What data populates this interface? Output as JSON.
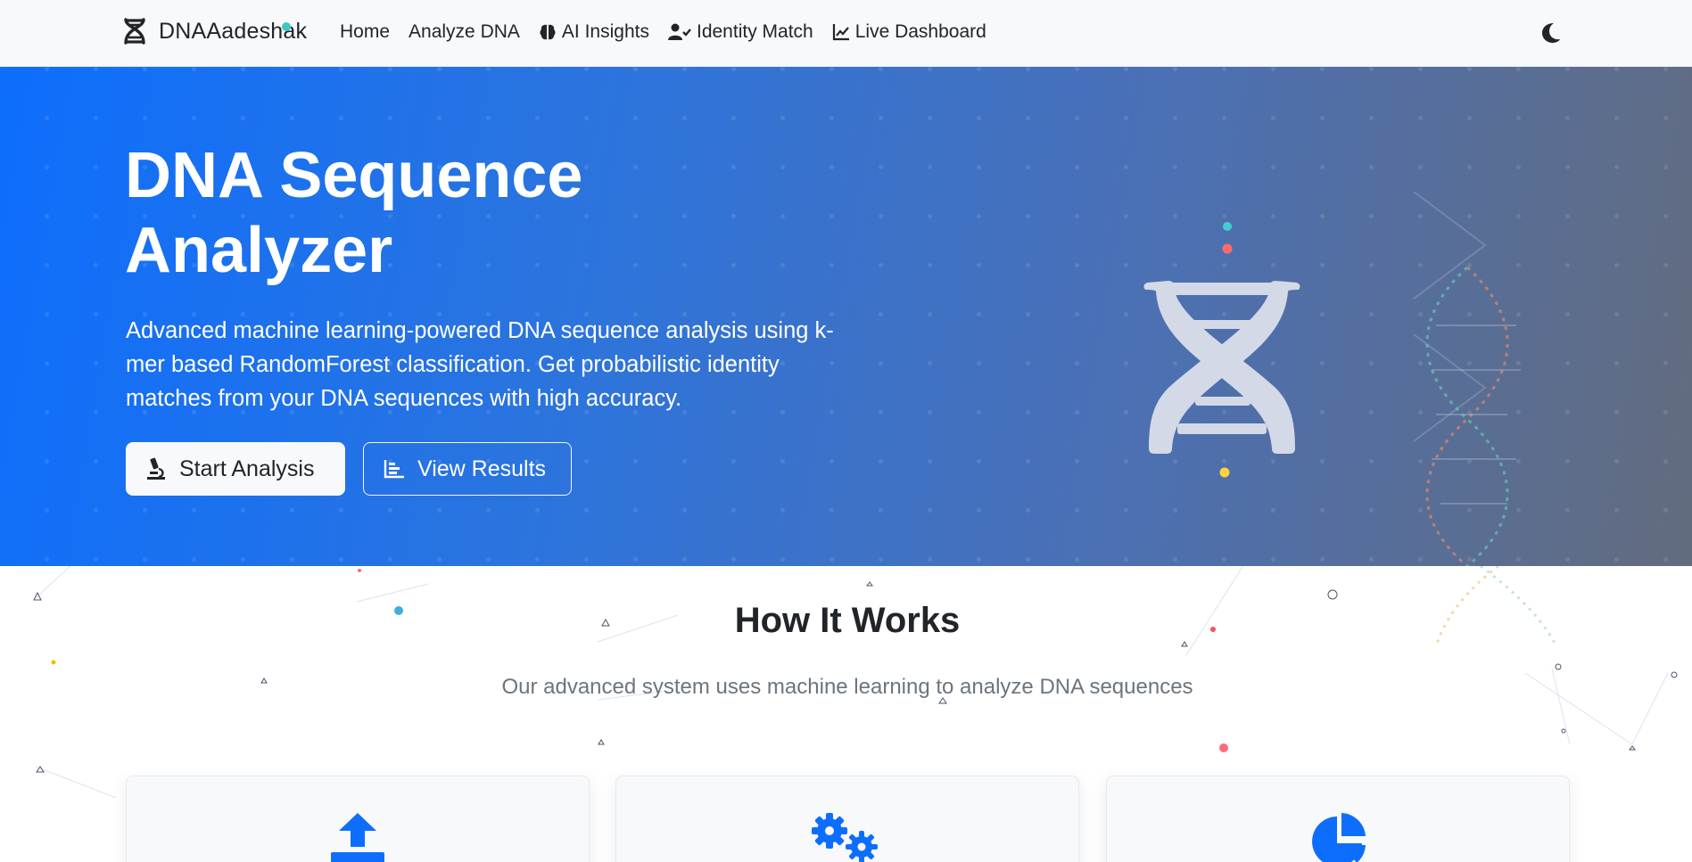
{
  "navbar": {
    "brand": "DNAAadeshak",
    "links": [
      {
        "label": "Home",
        "icon": ""
      },
      {
        "label": "Analyze DNA",
        "icon": ""
      },
      {
        "label": "AI Insights",
        "icon": "brain-icon"
      },
      {
        "label": "Identity Match",
        "icon": "user-check-icon"
      },
      {
        "label": "Live Dashboard",
        "icon": "chart-line-icon"
      }
    ],
    "theme_toggle_icon": "moon-icon"
  },
  "hero": {
    "title_line1": "DNA Sequence",
    "title_line2": "Analyzer",
    "description": "Advanced machine learning-powered DNA sequence analysis using k-mer based RandomForest classification. Get probabilistic identity matches from your DNA sequences with high accuracy.",
    "buttons": {
      "start": {
        "label": "Start Analysis",
        "icon": "microscope-icon"
      },
      "results": {
        "label": "View Results",
        "icon": "chart-bar-icon"
      }
    },
    "illustration_icon": "dna-icon"
  },
  "how_it_works": {
    "title": "How It Works",
    "subtitle": "Our advanced system uses machine learning to analyze DNA sequences",
    "cards": [
      {
        "icon": "upload-icon"
      },
      {
        "icon": "cogs-icon"
      },
      {
        "icon": "chart-pie-icon"
      }
    ]
  },
  "colors": {
    "accent": "#0d6efd",
    "hero_start": "#0d6efd",
    "hero_end": "#636c7e",
    "navbar_bg": "#f8f9fa",
    "muted_text": "#6c757d"
  }
}
